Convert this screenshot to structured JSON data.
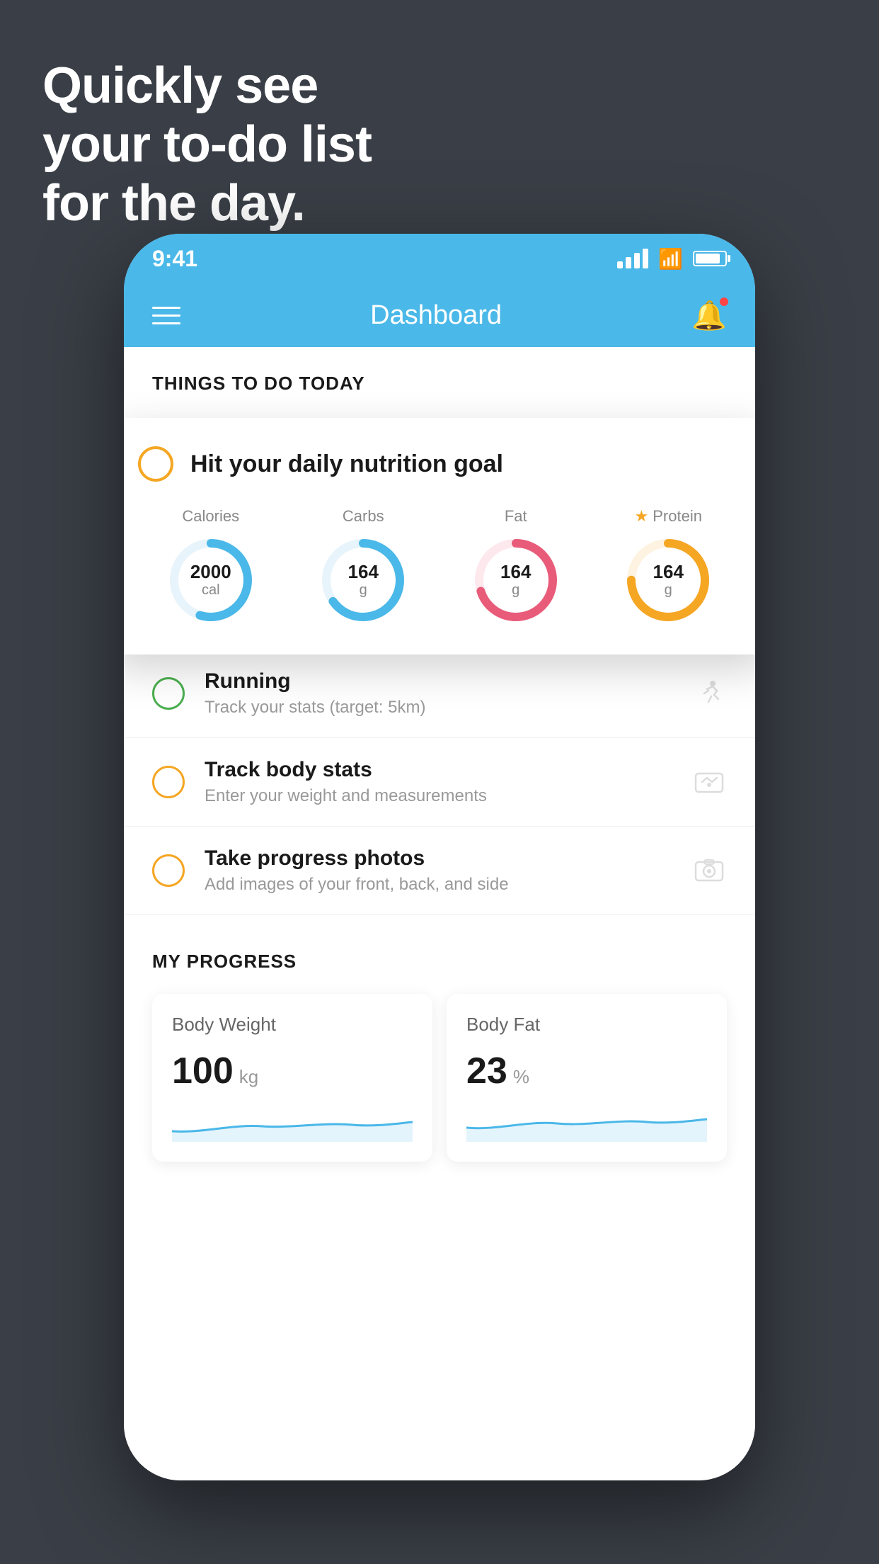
{
  "background": {
    "color": "#3a3f47"
  },
  "headline": {
    "line1": "Quickly see",
    "line2": "your to-do list",
    "line3": "for the day."
  },
  "phone": {
    "status_bar": {
      "time": "9:41"
    },
    "header": {
      "title": "Dashboard",
      "menu_icon": "hamburger-icon",
      "notification_icon": "bell-icon"
    },
    "section_title": "THINGS TO DO TODAY",
    "floating_card": {
      "circle_color": "#f5a623",
      "title": "Hit your daily nutrition goal",
      "stats": [
        {
          "label": "Calories",
          "value": "2000",
          "unit": "cal",
          "color": "#4ab8e8",
          "progress": 0.55
        },
        {
          "label": "Carbs",
          "value": "164",
          "unit": "g",
          "color": "#4ab8e8",
          "progress": 0.65
        },
        {
          "label": "Fat",
          "value": "164",
          "unit": "g",
          "color": "#e85c7a",
          "progress": 0.7
        },
        {
          "label": "Protein",
          "value": "164",
          "unit": "g",
          "color": "#f5a623",
          "progress": 0.75,
          "starred": true
        }
      ]
    },
    "todo_items": [
      {
        "circle_color": "green",
        "title": "Running",
        "subtitle": "Track your stats (target: 5km)",
        "icon": "running-icon"
      },
      {
        "circle_color": "yellow",
        "title": "Track body stats",
        "subtitle": "Enter your weight and measurements",
        "icon": "scale-icon"
      },
      {
        "circle_color": "yellow",
        "title": "Take progress photos",
        "subtitle": "Add images of your front, back, and side",
        "icon": "photo-icon"
      }
    ],
    "progress_section": {
      "title": "MY PROGRESS",
      "cards": [
        {
          "title": "Body Weight",
          "value": "100",
          "unit": "kg"
        },
        {
          "title": "Body Fat",
          "value": "23",
          "unit": "%"
        }
      ]
    }
  }
}
